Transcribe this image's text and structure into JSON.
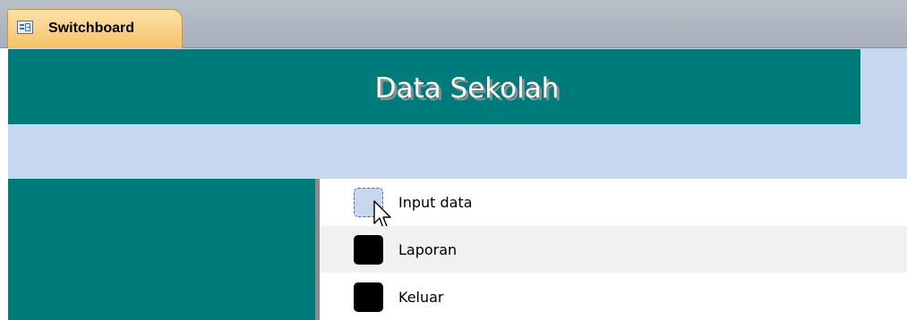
{
  "tab": {
    "label": "Switchboard",
    "icon": "form-icon"
  },
  "form": {
    "title": "Data Sekolah"
  },
  "menu": {
    "items": [
      {
        "label": "Input data",
        "state": "hover"
      },
      {
        "label": "Laporan"
      },
      {
        "label": "Keluar"
      }
    ]
  },
  "colors": {
    "header_band": "#007b7b",
    "form_background": "#c6d9f1",
    "tab_active": "#f6c268",
    "tab_bar": "#b1b7c1"
  }
}
